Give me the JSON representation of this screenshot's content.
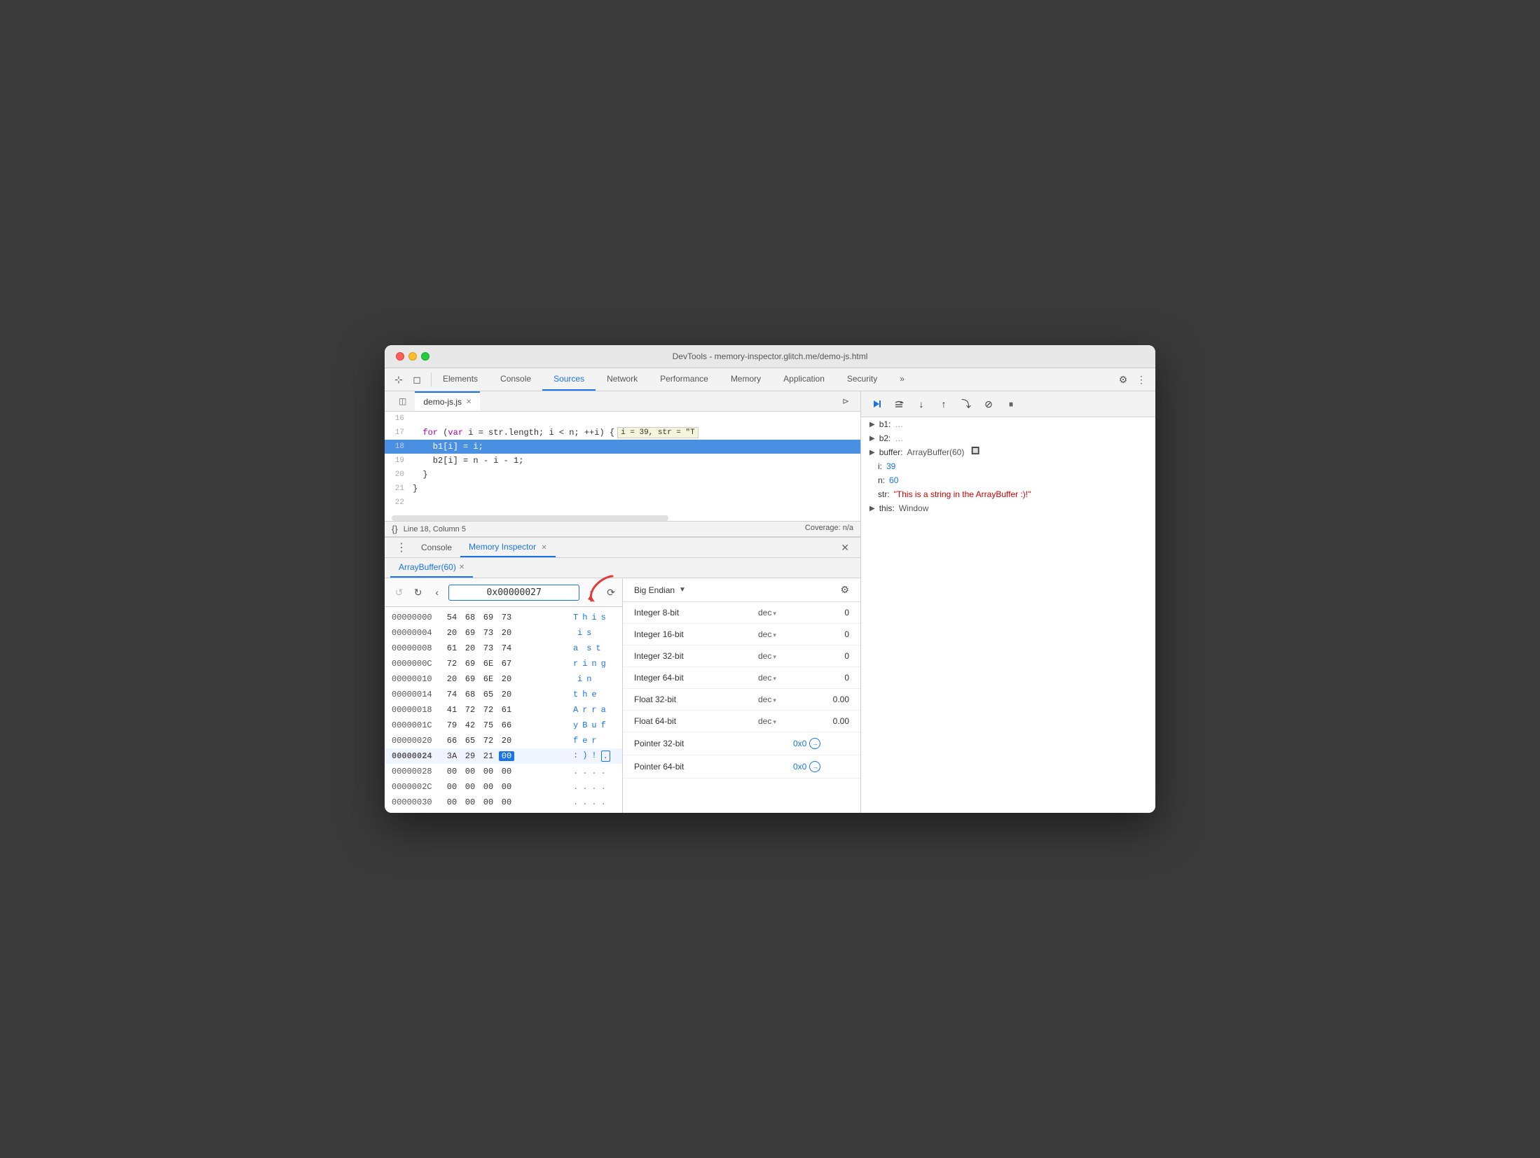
{
  "window": {
    "title": "DevTools - memory-inspector.glitch.me/demo-js.html"
  },
  "nav": {
    "tabs": [
      "Elements",
      "Console",
      "Sources",
      "Network",
      "Performance",
      "Memory",
      "Application",
      "Security"
    ],
    "active": "Sources"
  },
  "source_file": {
    "name": "demo-js.js",
    "lines": [
      {
        "num": "16",
        "text": ""
      },
      {
        "num": "17",
        "text": "  for (var i = str.length; i < n; ++i) {",
        "tooltip": "  i = 39, str = \"T"
      },
      {
        "num": "18",
        "text": "    b1[i] = i;",
        "highlight": true
      },
      {
        "num": "19",
        "text": "    b2[i] = n - i - 1;"
      },
      {
        "num": "20",
        "text": "  }"
      },
      {
        "num": "21",
        "text": "}"
      },
      {
        "num": "22",
        "text": ""
      }
    ]
  },
  "status_bar": {
    "position": "Line 18, Column 5",
    "coverage": "Coverage: n/a"
  },
  "bottom_tabs": {
    "tabs": [
      "Console",
      "Memory Inspector"
    ],
    "active": "Memory Inspector"
  },
  "memory_inspector": {
    "tab_label": "ArrayBuffer(60)",
    "address_value": "0x00000027",
    "rows": [
      {
        "addr": "00000000",
        "bytes": [
          "54",
          "68",
          "69",
          "73"
        ],
        "ascii": [
          "T",
          "h",
          "i",
          "s"
        ],
        "bold": false
      },
      {
        "addr": "00000004",
        "bytes": [
          "20",
          "69",
          "73",
          "20"
        ],
        "ascii": [
          "",
          "i",
          "s",
          ""
        ],
        "bold": false
      },
      {
        "addr": "00000008",
        "bytes": [
          "61",
          "20",
          "73",
          "74"
        ],
        "ascii": [
          "a",
          "",
          "s",
          "t"
        ],
        "bold": false
      },
      {
        "addr": "0000000C",
        "bytes": [
          "72",
          "69",
          "6E",
          "67"
        ],
        "ascii": [
          "r",
          "i",
          "n",
          "g"
        ],
        "bold": false
      },
      {
        "addr": "00000010",
        "bytes": [
          "20",
          "69",
          "6E",
          "20"
        ],
        "ascii": [
          "",
          "i",
          "n",
          ""
        ],
        "bold": false
      },
      {
        "addr": "00000014",
        "bytes": [
          "74",
          "68",
          "65",
          "20"
        ],
        "ascii": [
          "t",
          "h",
          "e",
          ""
        ],
        "bold": false
      },
      {
        "addr": "00000018",
        "bytes": [
          "41",
          "72",
          "72",
          "61"
        ],
        "ascii": [
          "A",
          "r",
          "r",
          "a"
        ],
        "bold": false
      },
      {
        "addr": "0000001C",
        "bytes": [
          "79",
          "42",
          "75",
          "66"
        ],
        "ascii": [
          "y",
          "B",
          "u",
          "f"
        ],
        "bold": false
      },
      {
        "addr": "00000020",
        "bytes": [
          "66",
          "65",
          "72",
          "20"
        ],
        "ascii": [
          "f",
          "e",
          "r",
          ""
        ],
        "bold": false
      },
      {
        "addr": "00000024",
        "bytes": [
          "3A",
          "29",
          "21",
          "00"
        ],
        "ascii": [
          ":",
          ")",
          "!",
          "."
        ],
        "bold": true,
        "highlight_byte": 3
      },
      {
        "addr": "00000028",
        "bytes": [
          "00",
          "00",
          "00",
          "00"
        ],
        "ascii": [
          ".",
          ".",
          ".",
          "."
        ],
        "bold": false
      },
      {
        "addr": "0000002C",
        "bytes": [
          "00",
          "00",
          "00",
          "00"
        ],
        "ascii": [
          ".",
          ".",
          ".",
          "."
        ],
        "bold": false
      },
      {
        "addr": "00000030",
        "bytes": [
          "00",
          "00",
          "00",
          "00"
        ],
        "ascii": [
          ".",
          ".",
          ".",
          "."
        ],
        "bold": false
      }
    ]
  },
  "scope": {
    "items": [
      {
        "key": "b1:",
        "value": "…",
        "arrow": true
      },
      {
        "key": "b2:",
        "value": "…",
        "arrow": true
      },
      {
        "key": "buffer:",
        "value": "ArrayBuffer(60)",
        "arrow": true,
        "has_icon": true
      },
      {
        "key": "i:",
        "value": "39",
        "indent": true
      },
      {
        "key": "n:",
        "value": "60",
        "indent": true
      },
      {
        "key": "str:",
        "value": "\"This is a string in the ArrayBuffer :)!\"",
        "indent": true,
        "red": true
      },
      {
        "key": "this:",
        "value": "Window",
        "arrow": true
      }
    ]
  },
  "values_panel": {
    "endian": "Big Endian",
    "rows": [
      {
        "label": "Integer 8-bit",
        "type": "dec",
        "value": "0"
      },
      {
        "label": "Integer 16-bit",
        "type": "dec",
        "value": "0"
      },
      {
        "label": "Integer 32-bit",
        "type": "dec",
        "value": "0"
      },
      {
        "label": "Integer 64-bit",
        "type": "dec",
        "value": "0"
      },
      {
        "label": "Float 32-bit",
        "type": "dec",
        "value": "0.00"
      },
      {
        "label": "Float 64-bit",
        "type": "dec",
        "value": "0.00"
      },
      {
        "label": "Pointer 32-bit",
        "type": "",
        "value": "0x0",
        "link": true
      },
      {
        "label": "Pointer 64-bit",
        "type": "",
        "value": "0x0",
        "link": true
      }
    ]
  },
  "toolbar": {
    "debug_buttons": [
      "▶",
      "⟳",
      "↓",
      "↑",
      "⤵",
      "⊘",
      "⏸"
    ]
  }
}
